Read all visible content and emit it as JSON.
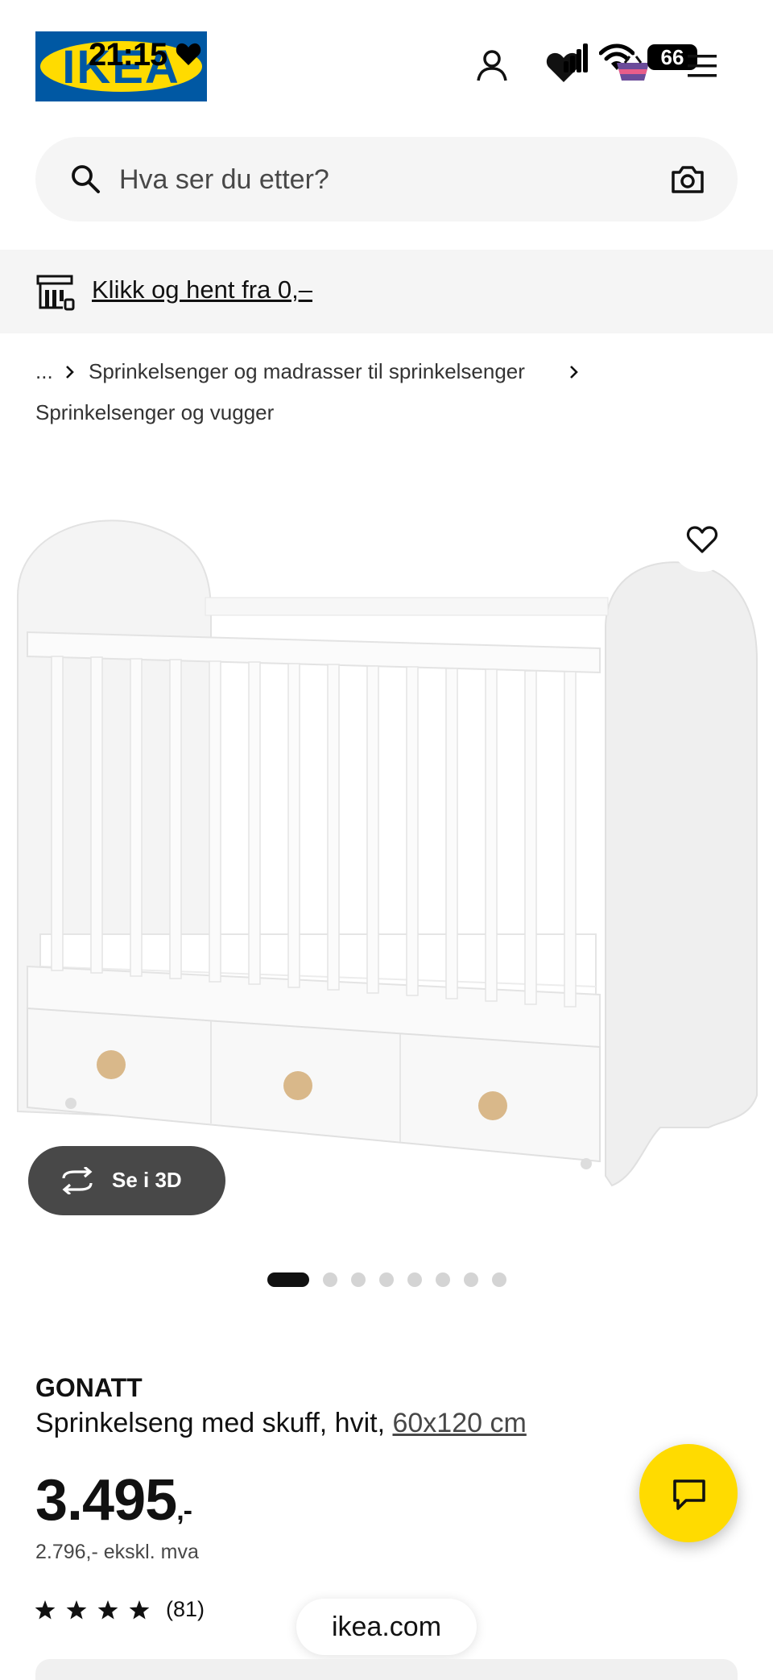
{
  "status_bar": {
    "time": "21:15",
    "battery": "66"
  },
  "header": {
    "logo_text": "IKEA",
    "icons": [
      "person-icon",
      "heart-icon",
      "basket-icon",
      "menu-icon"
    ],
    "basket_count": "0"
  },
  "search": {
    "placeholder": "Hva ser du etter?"
  },
  "collect": {
    "label": "Klikk og hent fra 0,–"
  },
  "breadcrumb": {
    "ellipsis": "...",
    "level1": "Sprinkelsenger og madrasser til sprinkelsenger",
    "level2": "Sprinkelsenger og vugger"
  },
  "gallery": {
    "view3d_label": "Se i 3D",
    "image_count": 9,
    "active_index": 0
  },
  "product": {
    "brand": "GONATT",
    "description": "Sprinkelseng med skuff, hvit, ",
    "size": "60x120 cm",
    "price": "3.495",
    "price_suffix": ",-",
    "price_ex_vat": "2.796,- ekskl. mva",
    "rating": 4,
    "rating_max": 5,
    "review_count": "(81)"
  },
  "browser": {
    "url": "ikea.com"
  },
  "colors": {
    "brand_blue": "#0058a3",
    "brand_yellow": "#ffdb00",
    "dark_button": "#484848"
  }
}
